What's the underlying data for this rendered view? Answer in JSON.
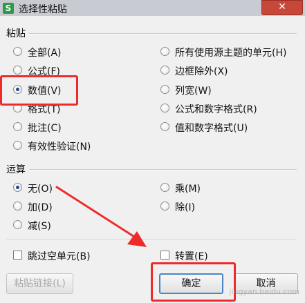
{
  "window": {
    "title": "选择性粘贴",
    "app_icon": "S",
    "close_label": "✕"
  },
  "paste_group": {
    "label": "粘贴",
    "options": [
      {
        "label": "全部(A)",
        "checked": false
      },
      {
        "label": "公式(F)",
        "checked": false
      },
      {
        "label": "数值(V)",
        "checked": true
      },
      {
        "label": "格式(T)",
        "checked": false
      },
      {
        "label": "批注(C)",
        "checked": false
      },
      {
        "label": "有效性验证(N)",
        "checked": false
      },
      {
        "label": "所有使用源主题的单元(H)",
        "checked": false
      },
      {
        "label": "边框除外(X)",
        "checked": false
      },
      {
        "label": "列宽(W)",
        "checked": false
      },
      {
        "label": "公式和数字格式(R)",
        "checked": false
      },
      {
        "label": "值和数字格式(U)",
        "checked": false
      }
    ]
  },
  "operation_group": {
    "label": "运算",
    "options": [
      {
        "label": "无(O)",
        "checked": true
      },
      {
        "label": "加(D)",
        "checked": false
      },
      {
        "label": "减(S)",
        "checked": false
      },
      {
        "label": "乘(M)",
        "checked": false
      },
      {
        "label": "除(I)",
        "checked": false
      }
    ]
  },
  "checkboxes": {
    "skip_blanks": {
      "label": "跳过空单元(B)",
      "checked": false
    },
    "transpose": {
      "label": "转置(E)",
      "checked": false
    }
  },
  "buttons": {
    "paste_link": "粘贴链接(L)",
    "ok": "确定",
    "cancel": "取消"
  },
  "watermark": "jingyan.baidu.com",
  "colors": {
    "annotation": "#ee2b2b",
    "close_button": "#c7483a",
    "radio_dot": "#1a4b8f"
  }
}
